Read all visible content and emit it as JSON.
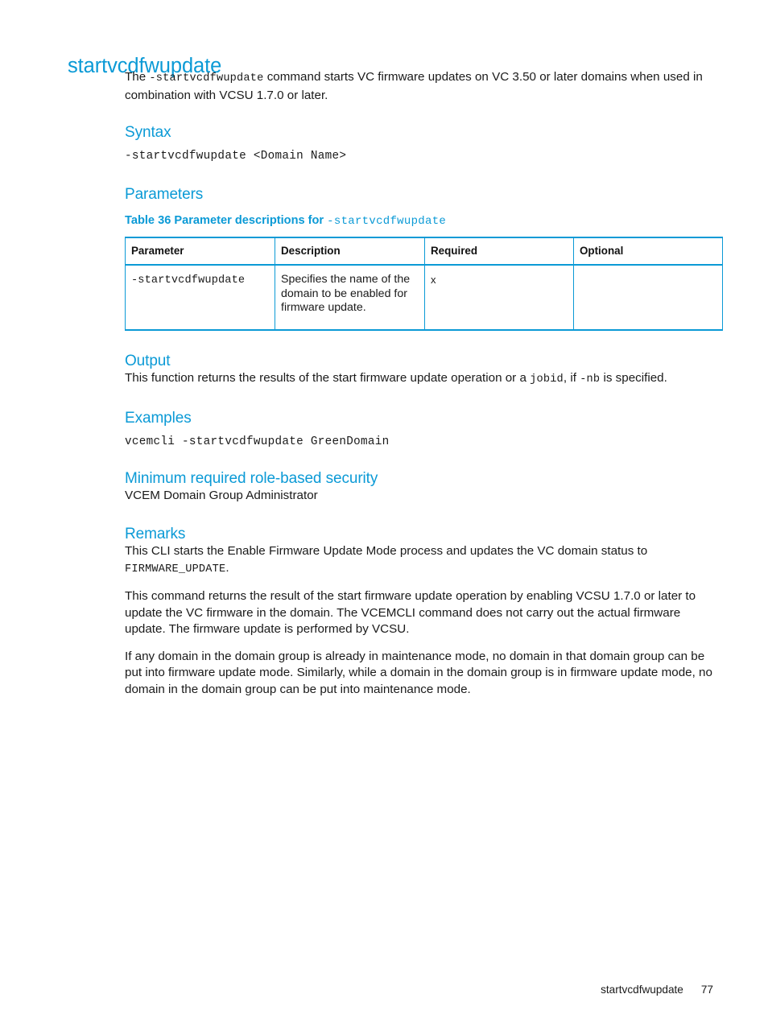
{
  "page": {
    "title": "startvcdfwupdate",
    "intro_before_code": "The ",
    "intro_code": "-startvcdfwupdate",
    "intro_after_code": " command starts VC firmware updates on VC 3.50 or later domains when used in combination with VCSU 1.7.0 or later."
  },
  "syntax": {
    "heading": "Syntax",
    "code": "-startvcdfwupdate <Domain Name>"
  },
  "parameters": {
    "heading": "Parameters",
    "caption_prefix": "Table 36 Parameter descriptions for ",
    "caption_code": "-startvcdfwupdate",
    "columns": [
      "Parameter",
      "Description",
      "Required",
      "Optional"
    ],
    "rows": [
      {
        "parameter": "-startvcdfwupdate",
        "description": "Specifies the name of the domain to be enabled for firmware update.",
        "required": "x",
        "optional": ""
      }
    ]
  },
  "output": {
    "heading": "Output",
    "text_part1": "This function returns the results of the start firmware update operation or a ",
    "code1": "jobid",
    "text_part2": ", if ",
    "code2": "-nb",
    "text_part3": " is specified."
  },
  "examples": {
    "heading": "Examples",
    "code": "vcemcli -startvcdfwupdate GreenDomain"
  },
  "role_security": {
    "heading": "Minimum required role-based security",
    "text": "VCEM Domain Group Administrator"
  },
  "remarks": {
    "heading": "Remarks",
    "para1_part1": "This CLI starts the Enable Firmware Update Mode process and updates the VC domain status to ",
    "para1_code": "FIRMWARE_UPDATE",
    "para1_part2": ".",
    "para2": "This command returns the result of the start firmware update operation by enabling VCSU 1.7.0 or later to update the VC firmware in the domain. The VCEMCLI command does not carry out the actual firmware update. The firmware update is performed by VCSU.",
    "para3": "If any domain in the domain group is already in maintenance mode, no domain in that domain group can be put into firmware update mode. Similarly, while a domain in the domain group is in firmware update mode, no domain in the domain group can be put into maintenance mode."
  },
  "footer": {
    "section": "startvcdfwupdate",
    "page_number": "77"
  },
  "colors": {
    "heading_blue": "#0b9ad6",
    "table_border_blue": "#0b9ad6",
    "body_text": "#1a1a1a"
  }
}
